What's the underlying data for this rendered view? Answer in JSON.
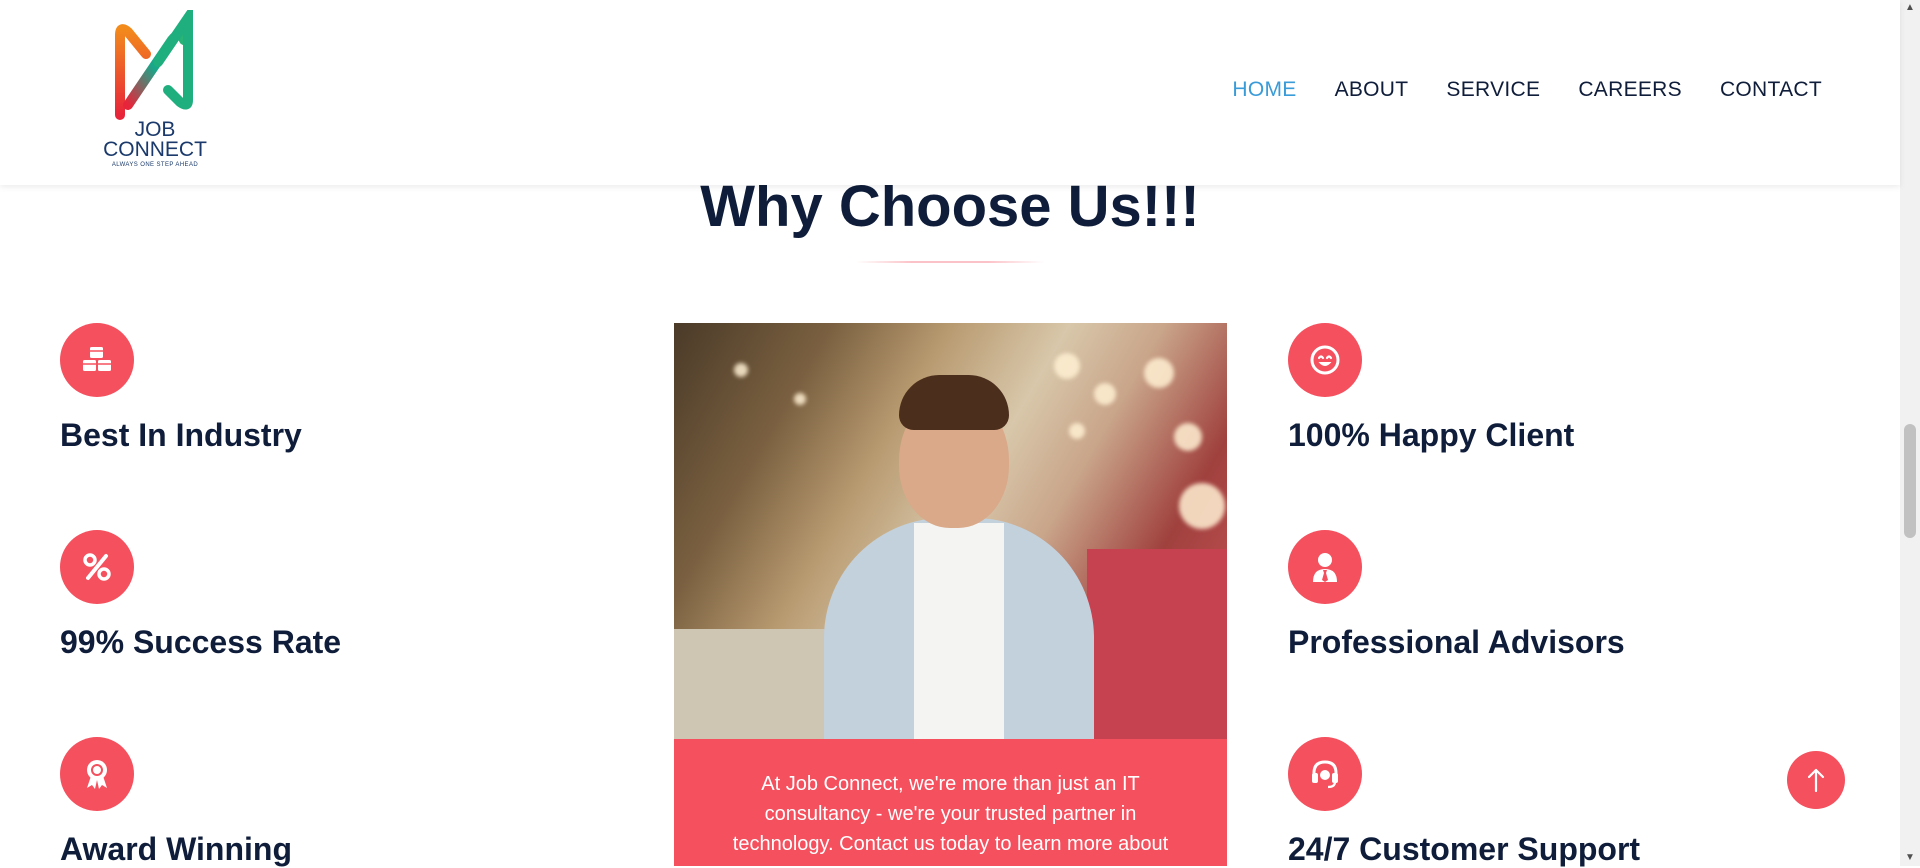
{
  "header": {
    "logo": {
      "line1": "JOB",
      "line2": "CONNECT",
      "tagline": "ALWAYS ONE STEP AHEAD",
      "colors": [
        "#f05a28",
        "#e8243a",
        "#2ab27b",
        "#1b3a6b"
      ]
    },
    "nav": [
      {
        "label": "HOME",
        "active": true
      },
      {
        "label": "ABOUT",
        "active": false
      },
      {
        "label": "SERVICE",
        "active": false
      },
      {
        "label": "CAREERS",
        "active": false
      },
      {
        "label": "CONTACT",
        "active": false
      }
    ]
  },
  "section": {
    "title": "Why Choose Us!!!"
  },
  "features_left": [
    {
      "icon": "cubes-icon",
      "title": "Best In Industry"
    },
    {
      "icon": "percent-icon",
      "title": "99% Success Rate"
    },
    {
      "icon": "award-icon",
      "title": "Award Winning"
    }
  ],
  "features_right": [
    {
      "icon": "smile-icon",
      "title": "100% Happy Client"
    },
    {
      "icon": "user-tie-icon",
      "title": "Professional Advisors"
    },
    {
      "icon": "headset-icon",
      "title": "24/7 Customer Support"
    }
  ],
  "center_card": {
    "caption": "At Job Connect, we're more than just an IT consultancy - we're your trusted partner in technology. Contact us today to learn more about"
  },
  "colors": {
    "accent": "#f4505e",
    "heading": "#0f1d3a",
    "nav_active": "#3a9bd9"
  }
}
